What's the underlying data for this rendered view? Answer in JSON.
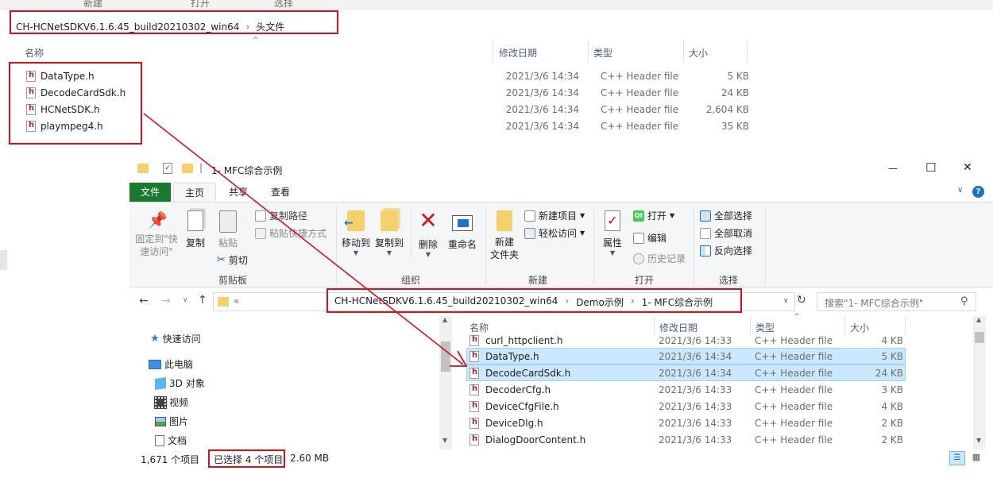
{
  "top_window": {
    "toolbar_labels": [
      "新建",
      "打开",
      "选择"
    ],
    "breadcrumb": {
      "path1": "CH-HCNetSDKV6.1.6.45_build20210302_win64",
      "sep": "›",
      "path2": "头文件"
    },
    "columns": {
      "name": "名称",
      "date": "修改日期",
      "type": "类型",
      "size": "大小"
    },
    "files": [
      {
        "name": "DataType.h",
        "date": "2021/3/6 14:34",
        "type": "C++ Header file",
        "size": "5 KB"
      },
      {
        "name": "DecodeCardSdk.h",
        "date": "2021/3/6 14:34",
        "type": "C++ Header file",
        "size": "24 KB"
      },
      {
        "name": "HCNetSDK.h",
        "date": "2021/3/6 14:34",
        "type": "C++ Header file",
        "size": "2,604 KB"
      },
      {
        "name": "plaympeg4.h",
        "date": "2021/3/6 14:34",
        "type": "C++ Header file",
        "size": "35 KB"
      }
    ]
  },
  "window": {
    "title": "1- MFC综合示例",
    "controls": {
      "min": "—",
      "max": "☐",
      "close": "✕"
    },
    "tabs": [
      "文件",
      "主页",
      "共享",
      "查看"
    ],
    "help": "?",
    "ribbon": {
      "clipboard": {
        "pin": "固定到\"快\n速访问\"",
        "copy": "复制",
        "paste": "粘贴",
        "copy_path": "复制路径",
        "paste_shortcut": "粘贴快捷方式",
        "cut": "剪切",
        "label": "剪贴板"
      },
      "organize": {
        "move_to": "移动到",
        "copy_to": "复制到",
        "delete": "删除",
        "rename": "重命名",
        "label": "组织"
      },
      "new": {
        "new_folder": "新建\n文件夹",
        "new_item": "新建项目",
        "easy_access": "轻松访问",
        "label": "新建"
      },
      "open": {
        "properties": "属性",
        "open": "打开",
        "edit": "编辑",
        "history": "历史记录",
        "label": "打开"
      },
      "select": {
        "select_all": "全部选择",
        "select_none": "全部取消",
        "invert": "反向选择",
        "label": "选择"
      }
    },
    "address": {
      "back": "←",
      "forward": "→",
      "up": "↑",
      "ellipsis": "«",
      "path1": "CH-HCNetSDKV6.1.6.45_build20210302_win64",
      "sep1": "›",
      "path2": "Demo示例",
      "sep2": "›",
      "path3": "1- MFC综合示例",
      "refresh": "↻",
      "search_placeholder": "搜索\"1- MFC综合示例\""
    },
    "nav": [
      {
        "label": "快速访问"
      },
      {
        "label": "此电脑"
      },
      {
        "label": "3D 对象"
      },
      {
        "label": "视频"
      },
      {
        "label": "图片"
      },
      {
        "label": "文档"
      }
    ],
    "columns": {
      "name": "名称",
      "date": "修改日期",
      "type": "类型",
      "size": "大小"
    },
    "files": [
      {
        "name": "curl_httpclient.h",
        "date": "2021/3/6 14:33",
        "type": "C++ Header file",
        "size": "4 KB",
        "selected": false
      },
      {
        "name": "DataType.h",
        "date": "2021/3/6 14:34",
        "type": "C++ Header file",
        "size": "5 KB",
        "selected": true
      },
      {
        "name": "DecodeCardSdk.h",
        "date": "2021/3/6 14:34",
        "type": "C++ Header file",
        "size": "24 KB",
        "selected": true
      },
      {
        "name": "DecoderCfg.h",
        "date": "2021/3/6 14:33",
        "type": "C++ Header file",
        "size": "3 KB",
        "selected": false
      },
      {
        "name": "DeviceCfgFile.h",
        "date": "2021/3/6 14:33",
        "type": "C++ Header file",
        "size": "4 KB",
        "selected": false
      },
      {
        "name": "DeviceDlg.h",
        "date": "2021/3/6 14:33",
        "type": "C++ Header file",
        "size": "2 KB",
        "selected": false
      },
      {
        "name": "DialogDoorContent.h",
        "date": "2021/3/6 14:33",
        "type": "C++ Header file",
        "size": "2 KB",
        "selected": false
      }
    ],
    "status": {
      "count": "1,671 个项目",
      "selected": "已选择 4 个项目",
      "size": "2.60 MB"
    }
  },
  "colors": {
    "annotation_red": "#d4121c",
    "file_tab": "#19792f",
    "selection": "#cce8ff"
  }
}
